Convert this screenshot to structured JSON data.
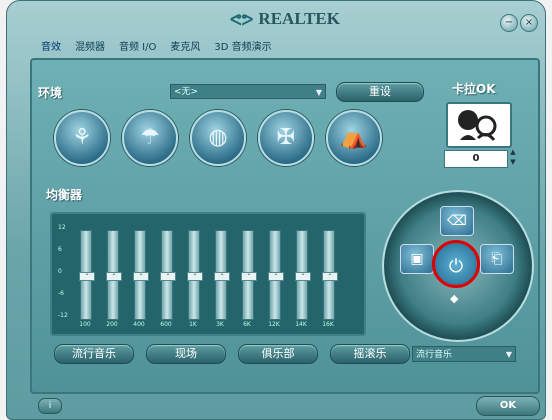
{
  "window": {
    "brand": "REALTEK",
    "min_label": "−",
    "close_label": "×"
  },
  "tabs": [
    "音效",
    "混频器",
    "音频 I/O",
    "麦克风",
    "3D 音频演示"
  ],
  "environment": {
    "label": "环境",
    "selected": "<无>",
    "reset_label": "重设",
    "icons": [
      "stage-icon",
      "bathroom-icon",
      "stadium-icon",
      "arena-icon",
      "opera-house-icon"
    ]
  },
  "karaoke": {
    "label": "卡拉OK",
    "value": "0"
  },
  "equalizer": {
    "label": "均衡器",
    "scale": [
      "12",
      "6",
      "0",
      "-6",
      "-12"
    ],
    "bands": [
      {
        "freq": "100",
        "level": 0
      },
      {
        "freq": "200",
        "level": 0
      },
      {
        "freq": "400",
        "level": 0
      },
      {
        "freq": "600",
        "level": 0
      },
      {
        "freq": "1K",
        "level": 0
      },
      {
        "freq": "3K",
        "level": 0
      },
      {
        "freq": "6K",
        "level": 0
      },
      {
        "freq": "12K",
        "level": 0
      },
      {
        "freq": "14K",
        "level": 0
      },
      {
        "freq": "16K",
        "level": 0
      }
    ],
    "presets": [
      "流行音乐",
      "现场",
      "俱乐部",
      "摇滚乐"
    ],
    "preset_select": "流行音乐"
  },
  "footer": {
    "ok_label": "OK",
    "info_label": "i"
  }
}
